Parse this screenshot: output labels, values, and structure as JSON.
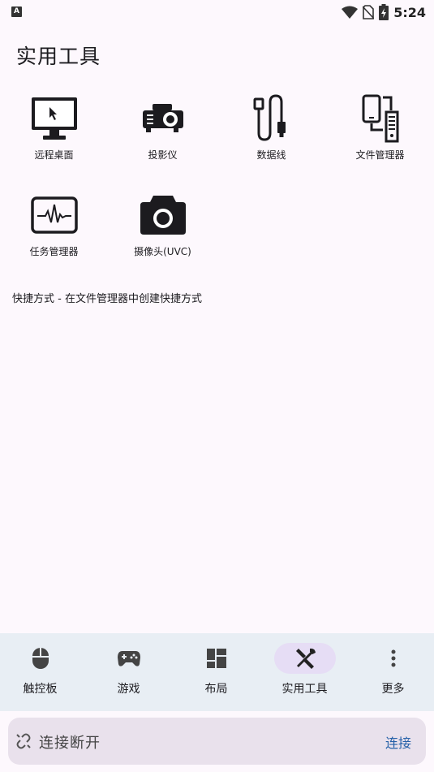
{
  "status_bar": {
    "left_icon_letter": "A",
    "time": "5:24",
    "icons": [
      "notification-app-icon",
      "wifi-icon",
      "no-sim-icon",
      "battery-charging-icon"
    ]
  },
  "page": {
    "title": "实用工具"
  },
  "tools": [
    {
      "label": "远程桌面",
      "icon": "remote-desktop-icon"
    },
    {
      "label": "投影仪",
      "icon": "projector-icon"
    },
    {
      "label": "数据线",
      "icon": "usb-cable-icon"
    },
    {
      "label": "文件管理器",
      "icon": "file-manager-icon"
    },
    {
      "label": "任务管理器",
      "icon": "task-manager-icon"
    },
    {
      "label": "摄像头(UVC)",
      "icon": "camera-icon"
    }
  ],
  "shortcut_note": "快捷方式 - 在文件管理器中创建快捷方式",
  "bottom_nav": {
    "items": [
      {
        "label": "触控板",
        "icon": "mouse-icon",
        "active": false
      },
      {
        "label": "游戏",
        "icon": "gamepad-icon",
        "active": false
      },
      {
        "label": "布局",
        "icon": "layout-icon",
        "active": false
      },
      {
        "label": "实用工具",
        "icon": "tools-icon",
        "active": true
      },
      {
        "label": "更多",
        "icon": "more-vert-icon",
        "active": false
      }
    ]
  },
  "connection": {
    "status": "连接断开",
    "action_label": "连接",
    "icon": "link-off-icon"
  },
  "colors": {
    "background": "#fdf8fd",
    "nav_background": "#e8eef4",
    "nav_active_pill": "#e6ddf5",
    "connection_bar": "#e9e1ec",
    "connect_link": "#2560a8"
  }
}
